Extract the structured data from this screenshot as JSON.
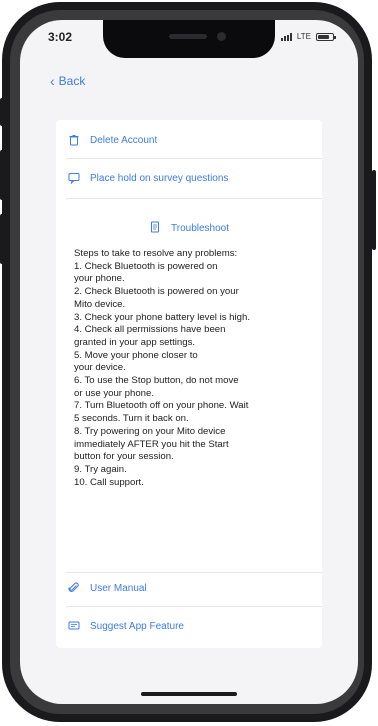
{
  "status": {
    "time": "3:02",
    "network": "LTE"
  },
  "nav": {
    "back_label": "Back"
  },
  "menu": {
    "delete_account": "Delete Account",
    "survey_placeholder": "Place hold on survey questions",
    "troubleshoot": "Troubleshoot",
    "user_manual": "User Manual",
    "suggest_feature": "Suggest App Feature"
  },
  "troubleshoot_steps": [
    "Steps to take to resolve any problems:",
    "1. Check Bluetooth is powered on",
    "your phone.",
    "2. Check Bluetooth is powered on your",
    "Mito device.",
    "3. Check your phone battery level is high.",
    "4. Check all permissions have been",
    "granted in your app settings.",
    "5. Move your phone closer to",
    "your device.",
    "6. To use the Stop button, do not move",
    "or use your phone.",
    "7. Turn Bluetooth off on your phone. Wait",
    "5 seconds. Turn it back on.",
    "8. Try powering on your Mito device",
    "immediately AFTER you hit the Start",
    "button for your session.",
    "9. Try again.",
    "10. Call support."
  ],
  "colors": {
    "accent": "#3d7be8",
    "background": "#f4f4f7",
    "card": "#ffffff",
    "text": "#1e1e1e"
  },
  "icons": {
    "delete_account": "trash-icon",
    "survey_placeholder": "chat-bubble-icon",
    "troubleshoot": "document-icon",
    "user_manual": "paperclip-icon",
    "suggest_feature": "feedback-icon"
  }
}
